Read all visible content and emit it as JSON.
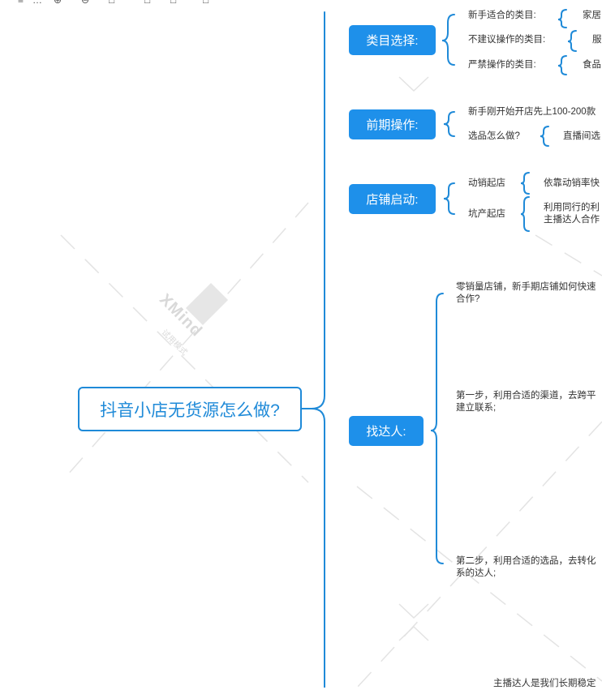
{
  "toolbar": {
    "glyphs": [
      "≡",
      "…",
      "⊕",
      "⊖",
      "□",
      "□",
      "□",
      "□"
    ]
  },
  "watermark": {
    "brand": "XMind",
    "sub": "试用模式"
  },
  "root": {
    "label": "抖音小店无货源怎么做?"
  },
  "branches": [
    {
      "label": "类目选择:",
      "children": [
        {
          "label": "新手适合的类目:",
          "detail": "家居"
        },
        {
          "label": "不建议操作的类目:",
          "detail": "服"
        },
        {
          "label": "严禁操作的类目:",
          "detail": "食品"
        }
      ]
    },
    {
      "label": "前期操作:",
      "children": [
        {
          "label": "新手刚开始开店先上100-200款"
        },
        {
          "label": "选品怎么做?",
          "detail": "直播间选"
        }
      ]
    },
    {
      "label": "店铺启动:",
      "children": [
        {
          "label": "动销起店",
          "detail": "依靠动销率快"
        },
        {
          "label": "坑产起店",
          "detail": "利用同行的利",
          "detail2": "主播达人合作"
        }
      ]
    },
    {
      "label": "找达人:",
      "children": [
        {
          "label": "零销量店铺，新手期店铺如何快速",
          "label2": "合作?"
        },
        {
          "label": "第一步，利用合适的渠道，去跨平",
          "label2": "建立联系;"
        },
        {
          "label": "第二步，利用合适的选品，去转化",
          "label2": "系的达人;"
        },
        {
          "label": "主播达人是我们长期稳定"
        }
      ]
    }
  ]
}
